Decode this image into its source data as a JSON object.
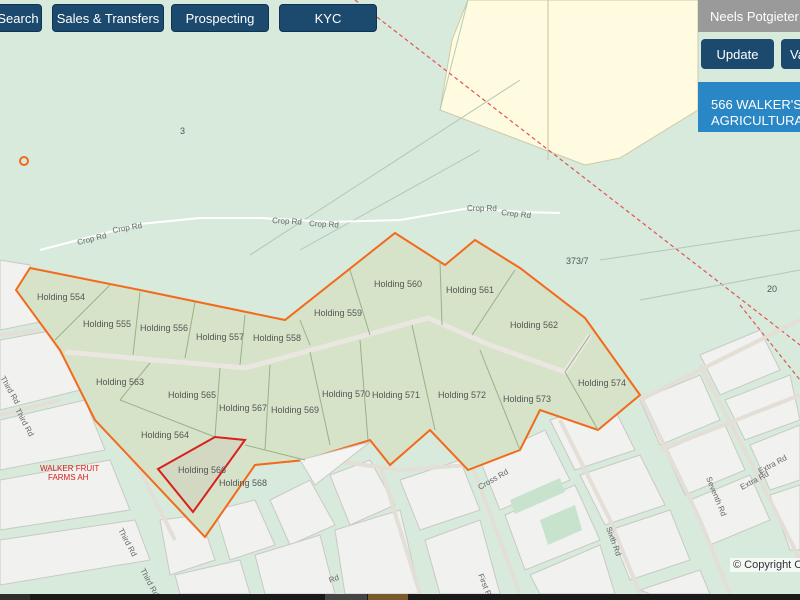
{
  "toolbar": {
    "search_label": "Search",
    "sales_label": "Sales & Transfers",
    "prospecting_label": "Prospecting",
    "kyc_label": "KYC"
  },
  "user": {
    "name": "Neels Potgieter"
  },
  "actions": {
    "update_label": "Update",
    "v_label": "Va"
  },
  "info_panel": {
    "line1": "566 WALKER'S",
    "line2": "AGRICULTURA"
  },
  "map": {
    "copyright": "© Copyright C",
    "parcel_labels": {
      "p3": "3",
      "p373": "373/7",
      "p20": "20"
    },
    "road_labels": {
      "crop1": "Crop Rd",
      "crop2": "Crop Rd",
      "crop3": "Crop Rd",
      "crop4": "Crop Rd",
      "crop5": "Crop Rd",
      "crop6": "Crop Rd",
      "third1": "Third Rd",
      "third2": "Third Rd",
      "third3": "Third Rd",
      "third4": "Third Rd",
      "cross": "Cross Rd",
      "sixth": "Sixth Rd",
      "seventh": "Seventh Rd",
      "extra1": "Extra Rd",
      "extra2": "Extra Rd",
      "first": "First Rd",
      "ridge": "Rd"
    },
    "farm_label": {
      "line1": "WALKER FRUIT",
      "line2": "FARMS AH"
    },
    "holdings": {
      "h554": "Holding 554",
      "h555": "Holding 555",
      "h556": "Holding 556",
      "h557": "Holding 557",
      "h558": "Holding 558",
      "h559": "Holding 559",
      "h560": "Holding 560",
      "h561": "Holding 561",
      "h562": "Holding 562",
      "h563": "Holding 563",
      "h564": "Holding 564",
      "h565": "Holding 565",
      "h566": "Holding 566",
      "h567": "Holding 567",
      "h568": "Holding 568",
      "h569": "Holding 569",
      "h570": "Holding 570",
      "h571": "Holding 571",
      "h572": "Holding 572",
      "h573": "Holding 573",
      "h574": "Holding 574"
    },
    "selected_holding": "Holding 566",
    "colors": {
      "background": "#d7eadb",
      "cream_area": "#fffbe0",
      "holding_fill": "#d6e3c8",
      "boundary": "#f26a1b",
      "selected": "#d8201d",
      "road": "#eae6e0",
      "label": "#555555",
      "button": "#1c4a6e",
      "panel": "#2a87c5"
    }
  }
}
